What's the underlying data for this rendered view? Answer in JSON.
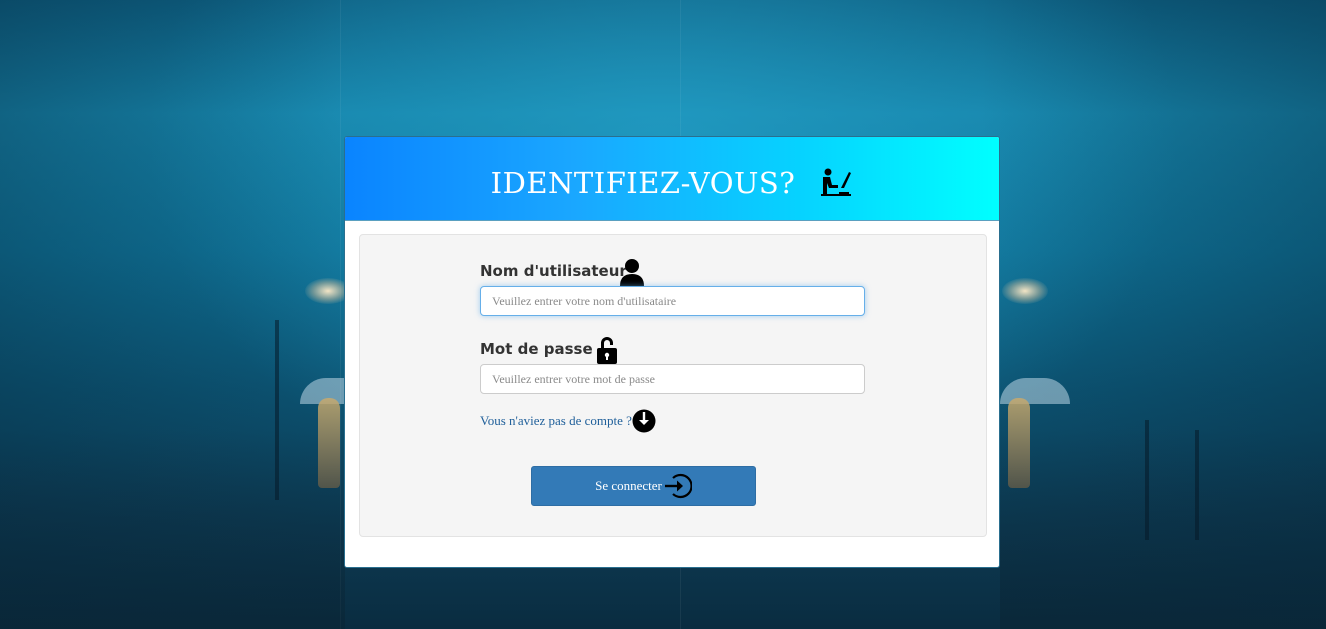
{
  "header": {
    "title": "IDENTIFIEZ-VOUS?"
  },
  "form": {
    "username": {
      "label": "Nom d'utilisateur",
      "placeholder": "Veuillez entrer votre nom d'utilisataire",
      "value": ""
    },
    "password": {
      "label": "Mot de passe",
      "placeholder": "Veuillez entrer votre mot de passe",
      "value": ""
    },
    "signup_link": "Vous n'aviez pas de compte ?",
    "submit_label": "Se connecter"
  },
  "icons": {
    "title": "person-at-desk-icon",
    "username": "user-icon",
    "password": "lock-icon",
    "signup": "arrow-down-circle-icon",
    "submit": "sign-in-arrow-icon"
  },
  "colors": {
    "header_gradient_start": "#0a84ff",
    "header_gradient_end": "#00ffff",
    "button": "#337ab7",
    "link": "#1f5f9a",
    "well": "#f5f5f5"
  }
}
